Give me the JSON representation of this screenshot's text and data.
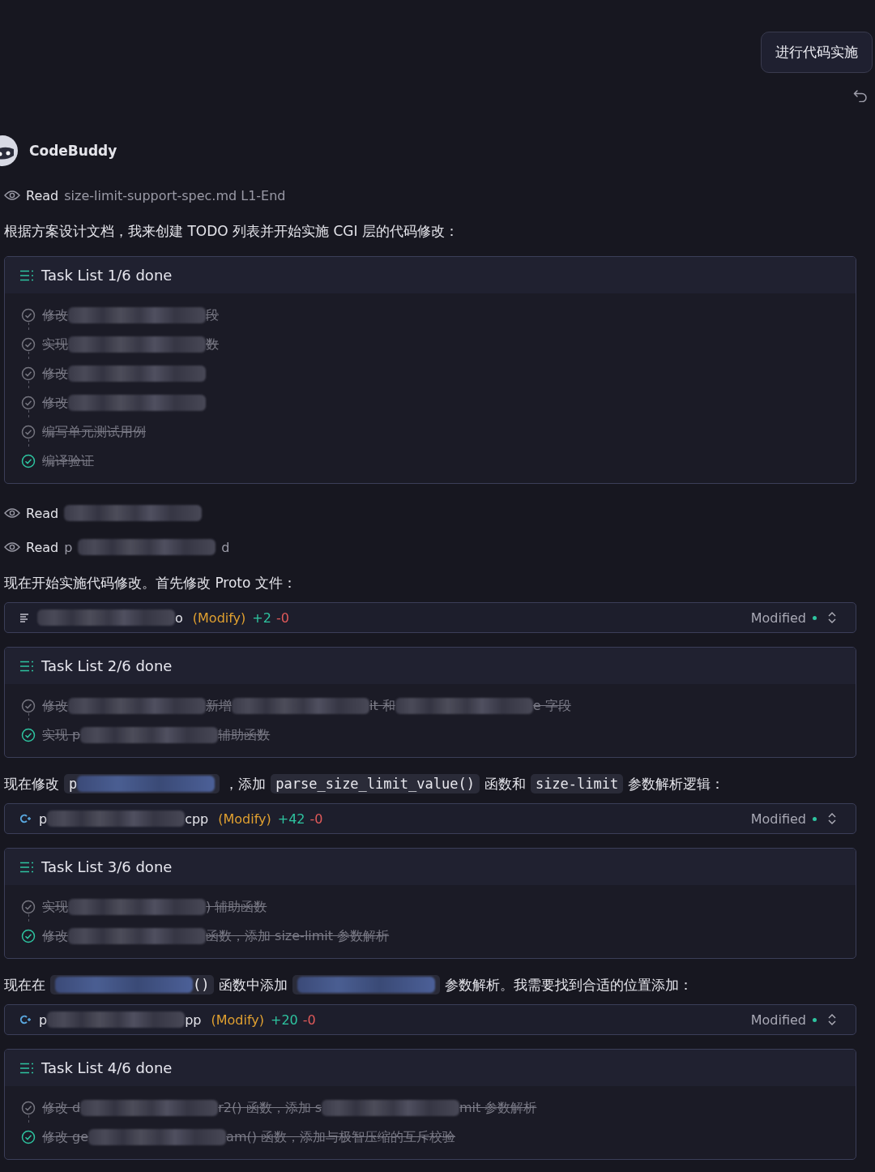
{
  "user_message": {
    "text": "进行代码实施"
  },
  "assistant": {
    "name": "CodeBuddy"
  },
  "blocks": [
    {
      "kind": "read",
      "label": "Read",
      "parts": [
        {
          "kind": "text",
          "text": "size-limit-support-spec.md L1-End"
        }
      ]
    },
    {
      "kind": "paragraph",
      "parts": [
        {
          "kind": "text",
          "text": "根据方案设计文档，我来创建 TODO 列表并开始实施 CGI 层的代码修改："
        }
      ]
    },
    {
      "kind": "tasks",
      "title": "Task List 1/6 done",
      "items": [
        {
          "just_completed": false,
          "parts": [
            {
              "kind": "text",
              "text": "修改"
            },
            {
              "kind": "blur"
            },
            {
              "kind": "text",
              "text": "段"
            }
          ]
        },
        {
          "just_completed": false,
          "parts": [
            {
              "kind": "text",
              "text": "实现"
            },
            {
              "kind": "blur"
            },
            {
              "kind": "text",
              "text": "数"
            }
          ]
        },
        {
          "just_completed": false,
          "parts": [
            {
              "kind": "text",
              "text": "修改"
            },
            {
              "kind": "blur"
            }
          ]
        },
        {
          "just_completed": false,
          "parts": [
            {
              "kind": "text",
              "text": "修改"
            },
            {
              "kind": "blur"
            }
          ]
        },
        {
          "just_completed": false,
          "parts": [
            {
              "kind": "text",
              "text": "编写单元测试用例"
            }
          ]
        },
        {
          "just_completed": true,
          "parts": [
            {
              "kind": "text",
              "text": "编译验证"
            }
          ]
        }
      ]
    },
    {
      "kind": "read",
      "label": "Read",
      "parts": [
        {
          "kind": "blur"
        }
      ]
    },
    {
      "kind": "read",
      "label": "Read",
      "parts": [
        {
          "kind": "text",
          "text": "p"
        },
        {
          "kind": "blur"
        },
        {
          "kind": "text",
          "text": "d"
        }
      ]
    },
    {
      "kind": "paragraph",
      "parts": [
        {
          "kind": "text",
          "text": "现在开始实施代码修改。首先修改 Proto 文件："
        }
      ]
    },
    {
      "kind": "file",
      "icon": {
        "kind": "lines"
      },
      "name_parts": [
        {
          "kind": "blur"
        },
        {
          "kind": "text",
          "text": "o"
        }
      ],
      "action": "(Modify)",
      "added": "+2",
      "removed": "-0",
      "status": "Modified"
    },
    {
      "kind": "tasks",
      "title": "Task List 2/6 done",
      "items": [
        {
          "just_completed": false,
          "parts": [
            {
              "kind": "text",
              "text": "修改"
            },
            {
              "kind": "blur"
            },
            {
              "kind": "text",
              "text": "新增"
            },
            {
              "kind": "blur"
            },
            {
              "kind": "text",
              "text": "it 和"
            },
            {
              "kind": "blur"
            },
            {
              "kind": "text",
              "text": "e 字段"
            }
          ]
        },
        {
          "just_completed": true,
          "parts": [
            {
              "kind": "text",
              "text": "实现 p"
            },
            {
              "kind": "blur"
            },
            {
              "kind": "text",
              "text": "辅助函数"
            }
          ]
        }
      ]
    },
    {
      "kind": "paragraph",
      "parts": [
        {
          "kind": "text",
          "text": "现在修改"
        },
        {
          "kind": "code",
          "parts": [
            {
              "kind": "text",
              "text": "p"
            },
            {
              "kind": "blur"
            }
          ]
        },
        {
          "kind": "text",
          "text": "，添加"
        },
        {
          "kind": "code",
          "parts": [
            {
              "kind": "text",
              "text": "parse_size_limit_value()"
            }
          ]
        },
        {
          "kind": "text",
          "text": "函数和"
        },
        {
          "kind": "code",
          "parts": [
            {
              "kind": "text",
              "text": "size-limit"
            }
          ]
        },
        {
          "kind": "text",
          "text": "参数解析逻辑："
        }
      ]
    },
    {
      "kind": "file",
      "icon": {
        "kind": "cpp"
      },
      "name_parts": [
        {
          "kind": "text",
          "text": "p"
        },
        {
          "kind": "blur"
        },
        {
          "kind": "text",
          "text": "cpp"
        }
      ],
      "action": "(Modify)",
      "added": "+42",
      "removed": "-0",
      "status": "Modified"
    },
    {
      "kind": "tasks",
      "title": "Task List 3/6 done",
      "items": [
        {
          "just_completed": false,
          "parts": [
            {
              "kind": "text",
              "text": "实现"
            },
            {
              "kind": "blur"
            },
            {
              "kind": "text",
              "text": ") 辅助函数"
            }
          ]
        },
        {
          "just_completed": true,
          "parts": [
            {
              "kind": "text",
              "text": "修改"
            },
            {
              "kind": "blur"
            },
            {
              "kind": "text",
              "text": "函数，添加 size-limit 参数解析"
            }
          ]
        }
      ]
    },
    {
      "kind": "paragraph",
      "parts": [
        {
          "kind": "text",
          "text": "现在在"
        },
        {
          "kind": "code",
          "parts": [
            {
              "kind": "blur"
            },
            {
              "kind": "text",
              "text": "()"
            }
          ]
        },
        {
          "kind": "text",
          "text": "函数中添加"
        },
        {
          "kind": "code",
          "parts": [
            {
              "kind": "blur"
            }
          ]
        },
        {
          "kind": "text",
          "text": "参数解析。我需要找到合适的位置添加："
        }
      ]
    },
    {
      "kind": "file",
      "icon": {
        "kind": "cpp"
      },
      "name_parts": [
        {
          "kind": "text",
          "text": "p"
        },
        {
          "kind": "blur"
        },
        {
          "kind": "text",
          "text": "pp"
        }
      ],
      "action": "(Modify)",
      "added": "+20",
      "removed": "-0",
      "status": "Modified"
    },
    {
      "kind": "tasks",
      "title": "Task List 4/6 done",
      "items": [
        {
          "just_completed": false,
          "parts": [
            {
              "kind": "text",
              "text": "修改 d"
            },
            {
              "kind": "blur"
            },
            {
              "kind": "text",
              "text": "r2() 函数，添加 s"
            },
            {
              "kind": "blur"
            },
            {
              "kind": "text",
              "text": "mit 参数解析"
            }
          ]
        },
        {
          "just_completed": true,
          "parts": [
            {
              "kind": "text",
              "text": "修改 ge"
            },
            {
              "kind": "blur"
            },
            {
              "kind": "text",
              "text": "am() 函数，添加与极智压缩的互斥校验"
            }
          ]
        }
      ]
    }
  ]
}
